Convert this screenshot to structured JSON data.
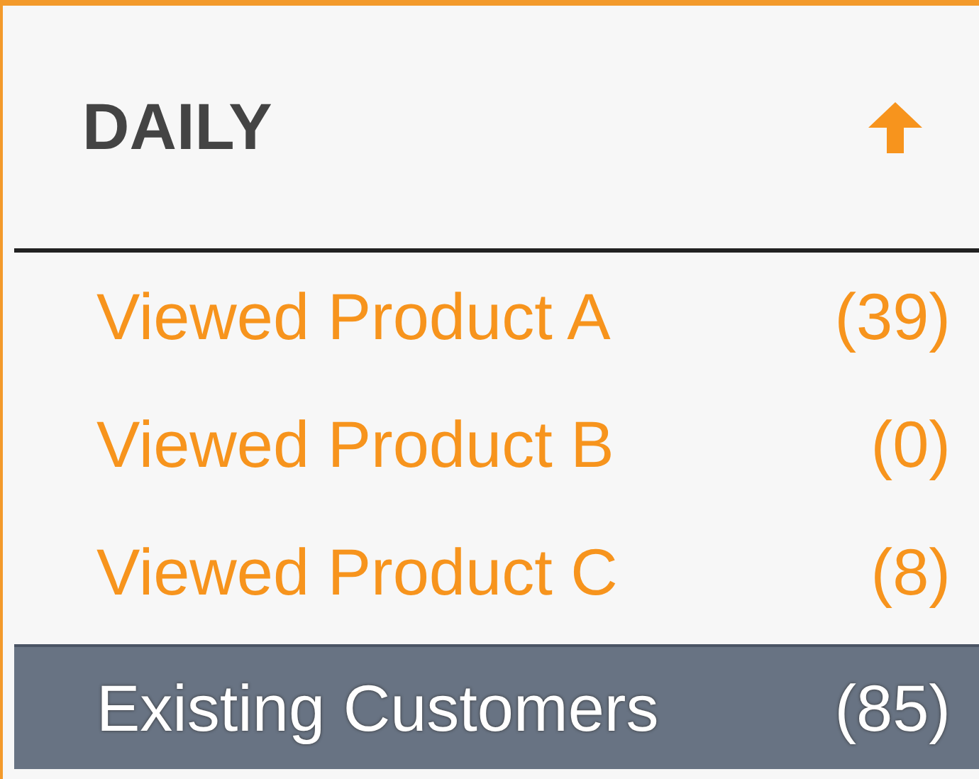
{
  "panel": {
    "title": "DAILY",
    "ascending": true
  },
  "items": [
    {
      "label": "Viewed Product A",
      "count": "(39)",
      "selected": false
    },
    {
      "label": "Viewed Product B",
      "count": "(0)",
      "selected": false
    },
    {
      "label": "Viewed Product C",
      "count": "(8)",
      "selected": false
    },
    {
      "label": "Existing Customers",
      "count": "(85)",
      "selected": true
    }
  ]
}
